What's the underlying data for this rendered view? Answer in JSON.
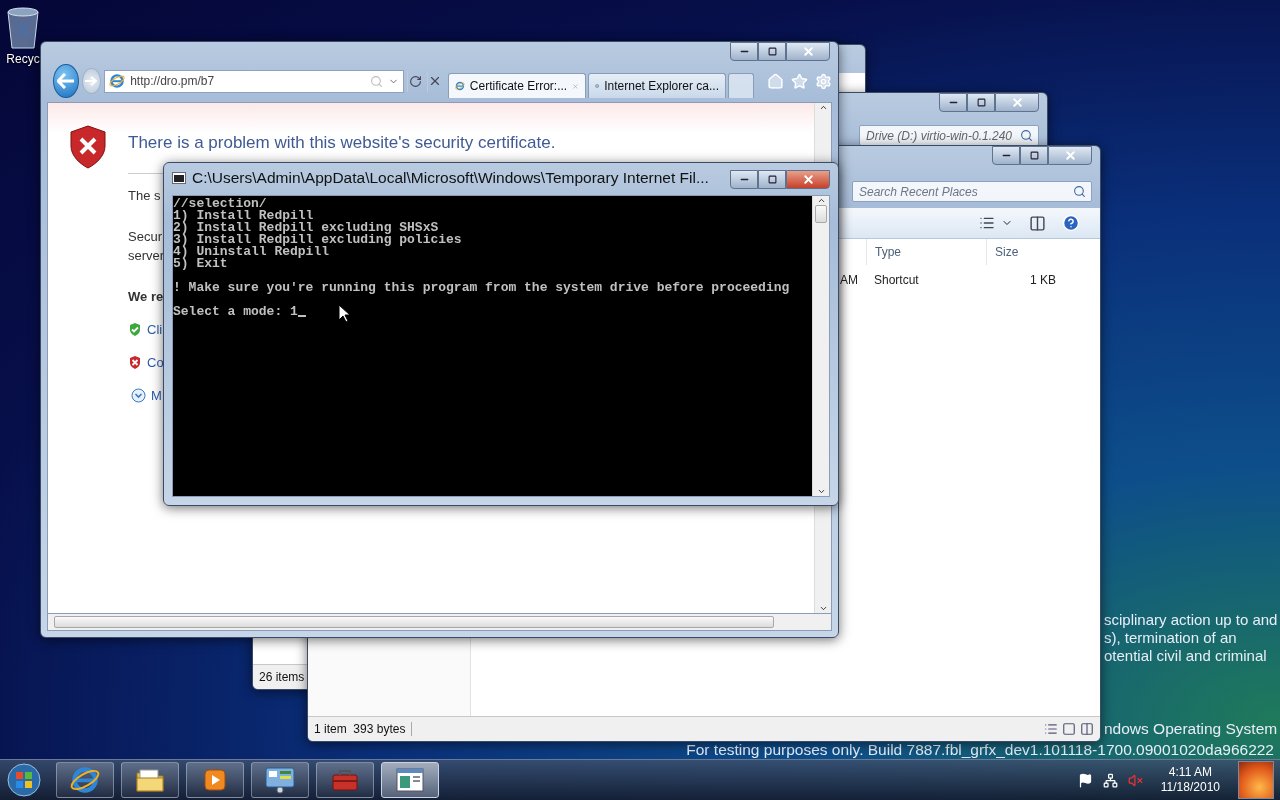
{
  "desktop": {
    "icons": [
      {
        "label": "Recyc"
      }
    ],
    "notice_lines": [
      "sciplinary action up to and",
      "s), termination of an",
      "otential civil and criminal"
    ],
    "os_label": "ndows Operating System",
    "build_line": "For testing purposes only. Build 7887.fbl_grfx_dev1.101118-1700.09001020da966222"
  },
  "explorer_back": {
    "status": "26 items"
  },
  "explorer_drive": {
    "search_value": "Drive (D:) virtio-win-0.1.240"
  },
  "explorer_recent": {
    "search_placeholder": "Search Recent Places",
    "columns": [
      "Type",
      "Size"
    ],
    "rows": [
      {
        "column_1": "AM",
        "type": "Shortcut",
        "size": "1 KB"
      }
    ],
    "status": "1 item  393 bytes"
  },
  "browser": {
    "address": "http://dro.pm/b7",
    "tabs": [
      {
        "label": "Certificate Error:...",
        "selected": true
      },
      {
        "label": "Internet Explorer ca...",
        "selected": false
      }
    ],
    "heading": "There is a problem with this website's security certificate.",
    "fragments": [
      {
        "kind": "text",
        "text": "The s"
      },
      {
        "kind": "text",
        "text": "Secur"
      },
      {
        "kind": "text",
        "text": "server"
      },
      {
        "kind": "bold",
        "text": "We re"
      },
      {
        "kind": "ok-link",
        "text": "Cli"
      },
      {
        "kind": "bad-link",
        "text": "Co"
      },
      {
        "kind": "more",
        "text": "M"
      }
    ]
  },
  "console": {
    "title": "C:\\Users\\Admin\\AppData\\Local\\Microsoft\\Windows\\Temporary Internet Fil...",
    "blocks": [
      {
        "lines": [
          "//selection/",
          "1) Install Redpill",
          "2) Install Redpill excluding SHSxS",
          "3) Install Redpill excluding policies",
          "4) Uninstall Redpill",
          "5) Exit"
        ]
      },
      {
        "lines": [
          "! Make sure you're running this program from the system drive before proceeding"
        ]
      },
      {
        "lines": [
          "Select a mode: 1"
        ]
      }
    ],
    "cursor": true
  },
  "taskbar": {
    "items": [
      {
        "kind": "browser",
        "selected": false
      },
      {
        "kind": "folder",
        "selected": false
      },
      {
        "kind": "media",
        "selected": false
      },
      {
        "kind": "control-panel",
        "selected": false
      },
      {
        "kind": "toolbox",
        "selected": false
      },
      {
        "kind": "window",
        "selected": true
      }
    ],
    "time": "4:11 AM",
    "date": "11/18/2010"
  }
}
